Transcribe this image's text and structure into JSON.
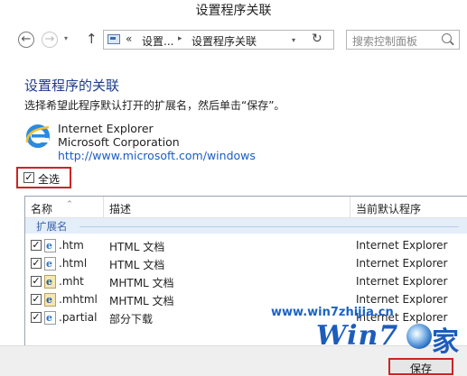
{
  "window": {
    "title": "设置程序关联"
  },
  "nav": {
    "back_glyph": "←",
    "forward_glyph": "→",
    "dropdown_glyph": "▾",
    "up_glyph": "↑",
    "address": {
      "chevron": "«",
      "segments": [
        "设置...",
        "设置程序关联"
      ],
      "separator": "▸",
      "dropdown_glyph": "▾",
      "refresh_glyph": "↻"
    },
    "search": {
      "placeholder": "搜索控制面板"
    }
  },
  "content": {
    "heading": "设置程序的关联",
    "instruction": "选择希望此程序默认打开的扩展名，然后单击“保存”。",
    "program": {
      "name": "Internet Explorer",
      "company": "Microsoft Corporation",
      "url": "http://www.microsoft.com/windows"
    },
    "select_all": {
      "label": "全选",
      "checked": true,
      "check_glyph": "✓"
    }
  },
  "table": {
    "columns": [
      "名称",
      "描述",
      "当前默认程序"
    ],
    "sort_glyph": "^",
    "group_label": "扩展名",
    "rows": [
      {
        "ext": ".htm",
        "desc": "HTML 文档",
        "program": "Internet Explorer",
        "icon": "ie-file-icon",
        "checked": true
      },
      {
        "ext": ".html",
        "desc": "HTML 文档",
        "program": "Internet Explorer",
        "icon": "ie-file-icon",
        "checked": true
      },
      {
        "ext": ".mht",
        "desc": "MHTML 文档",
        "program": "Internet Explorer",
        "icon": "mht-file-icon",
        "checked": true
      },
      {
        "ext": ".mhtml",
        "desc": "MHTML 文档",
        "program": "Internet Explorer",
        "icon": "mht-file-icon",
        "checked": true
      },
      {
        "ext": ".partial",
        "desc": "部分下载",
        "program": "Internet Explorer",
        "icon": "ie-file-icon",
        "checked": true
      }
    ]
  },
  "footer": {
    "save_label": "保存"
  },
  "watermark": {
    "url": "www.win7zhijia.cn",
    "brand": "Win7",
    "cn": "家"
  },
  "colors": {
    "heading": "#1e3c8c",
    "link": "#1a5cc6",
    "highlight": "#cc2424",
    "group_bg": "#e4eef9"
  }
}
